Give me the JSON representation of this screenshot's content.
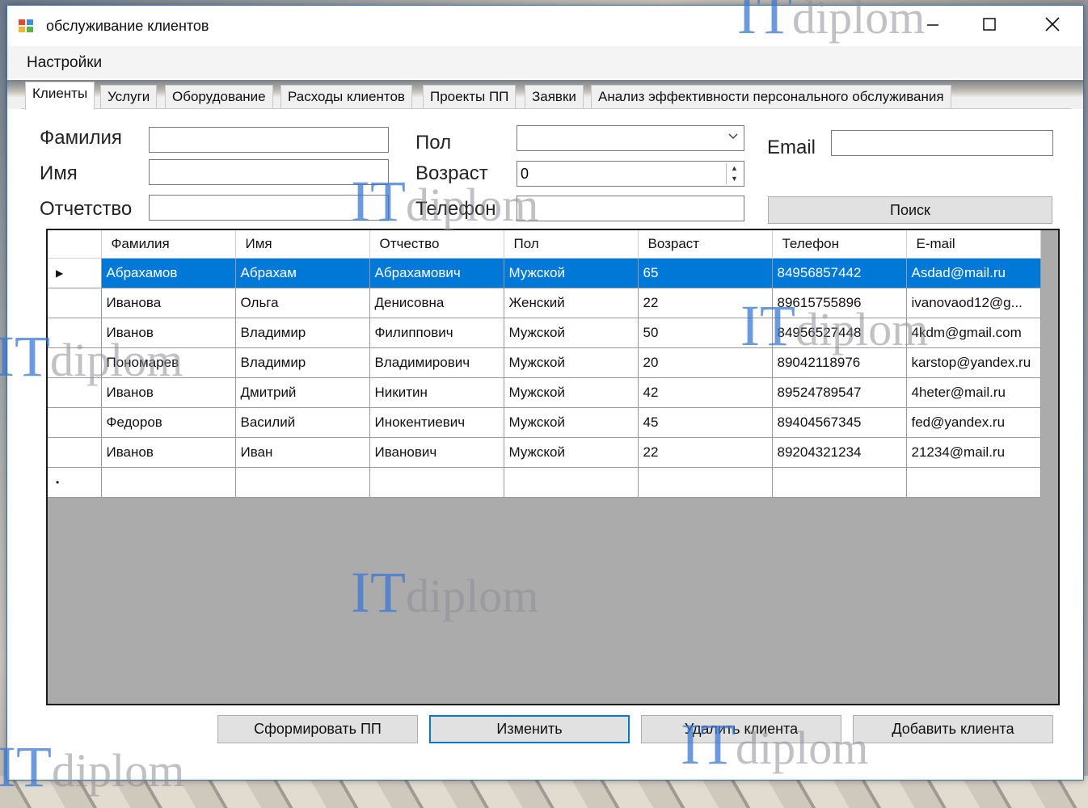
{
  "window": {
    "title": "обслуживание клиентов"
  },
  "menu": {
    "settings_label": "Настройки"
  },
  "tabs": [
    {
      "label": "Клиенты",
      "active": true
    },
    {
      "label": "Услуги"
    },
    {
      "label": "Оборудование"
    },
    {
      "label": "Расходы клиентов"
    },
    {
      "label": "Проекты ПП"
    },
    {
      "label": "Заявки"
    },
    {
      "label": "Анализ эффективности персонального обслуживания"
    }
  ],
  "form": {
    "surname_label": "Фамилия",
    "surname_value": "",
    "name_label": "Имя",
    "name_value": "",
    "patronymic_label": "Отчетство",
    "patronymic_value": "",
    "gender_label": "Пол",
    "gender_value": "",
    "age_label": "Возраст",
    "age_value": "0",
    "phone_label": "Телефон",
    "phone_value": "",
    "email_label": "Email",
    "email_value": "",
    "search_label": "Поиск"
  },
  "grid": {
    "columns": [
      "Фамилия",
      "Имя",
      "Отчество",
      "Пол",
      "Возраст",
      "Телефон",
      "E-mail"
    ],
    "rows": [
      [
        "Абрахамов",
        "Абрахам",
        "Абрахамович",
        "Мужской",
        "65",
        "84956857442",
        "Asdad@mail.ru"
      ],
      [
        "Иванова",
        "Ольга",
        "Денисовна",
        "Женский",
        "22",
        "89615755896",
        "ivanovaod12@g..."
      ],
      [
        "Иванов",
        "Владимир",
        "Филиппович",
        "Мужской",
        "50",
        "84956527448",
        "4kdm@gmail.com"
      ],
      [
        "Пономарев",
        "Владимир",
        "Владимирович",
        "Мужской",
        "20",
        "89042118976",
        "karstop@yandex.ru"
      ],
      [
        "Иванов",
        "Дмитрий",
        "Никитин",
        "Мужской",
        "42",
        "89524789547",
        "4heter@mail.ru"
      ],
      [
        "Федоров",
        "Василий",
        "Инокентиевич",
        "Мужской",
        "45",
        "89404567345",
        "fed@yandex.ru"
      ],
      [
        "Иванов",
        "Иван",
        "Иванович",
        "Мужской",
        "22",
        "89204321234",
        "21234@mail.ru"
      ]
    ],
    "selected_row": 0,
    "current_row_marker": "▶",
    "new_row_marker": "•"
  },
  "buttons": {
    "generate": "Сформировать ПП",
    "edit": "Изменить",
    "delete": "Удалить клиента",
    "add": "Добавить клиента"
  },
  "watermark": {
    "it": "IT",
    "diplom": "diplom"
  },
  "colors": {
    "selection": "#0078d7",
    "grid_background": "#ababab",
    "window_border": "#2f6fbf"
  }
}
